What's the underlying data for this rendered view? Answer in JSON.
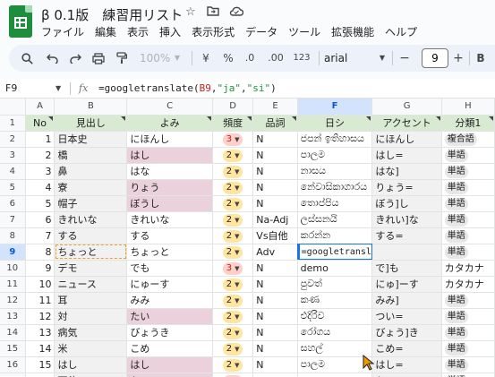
{
  "app": {
    "title": "β 0.1版　練習用リスト",
    "menu": [
      "ファイル",
      "編集",
      "表示",
      "挿入",
      "表示形式",
      "データ",
      "ツール",
      "拡張機能",
      "ヘルプ"
    ]
  },
  "toolbar": {
    "zoom": "100%",
    "currency": "¥",
    "percent": "%",
    "dec_decrease": ".0",
    "dec_increase": ".00",
    "number_format": "123",
    "font": "arial",
    "font_size": "9",
    "minus": "−",
    "plus": "+",
    "bold": "B"
  },
  "formula_bar": {
    "name_box": "F9",
    "fx": "fx",
    "formula_prefix": "=googletranslate(",
    "formula_ref": "B9",
    "formula_mid": ",",
    "formula_str1": "\"ja\"",
    "formula_comma": ",",
    "formula_str2": "\"si\"",
    "formula_suffix": ")"
  },
  "columns": [
    "A",
    "B",
    "C",
    "D",
    "E",
    "F",
    "G",
    "H"
  ],
  "header_row": {
    "row": "1",
    "cells": [
      "No",
      "見出し",
      "よみ",
      "頻度",
      "品詞",
      "日シ",
      "アクセント",
      "分類1"
    ]
  },
  "rows": [
    {
      "row": "2",
      "no": "1",
      "word": "日本史",
      "yomi": "にほんし",
      "freq": "3",
      "pos": "N",
      "si": "ජපන් ඉතිහාසය",
      "accent": "にほんし",
      "cat": "複合語"
    },
    {
      "row": "3",
      "no": "2",
      "word": "橋",
      "yomi": "はし",
      "freq": "2",
      "pos": "N",
      "si": "පාලම",
      "accent": "はし=",
      "cat": "単語"
    },
    {
      "row": "4",
      "no": "3",
      "word": "鼻",
      "yomi": "はな",
      "freq": "2",
      "pos": "N",
      "si": "නාසය",
      "accent": "はな]",
      "cat": "単語"
    },
    {
      "row": "5",
      "no": "4",
      "word": "寮",
      "yomi": "りょう",
      "freq": "2",
      "pos": "N",
      "si": "නේවාසිකාගාරය",
      "accent": "りょう=",
      "cat": "単語"
    },
    {
      "row": "6",
      "no": "5",
      "word": "帽子",
      "yomi": "ぼうし",
      "freq": "2",
      "pos": "N",
      "si": "තොප්පිය",
      "accent": "ぼう]し",
      "cat": "単語"
    },
    {
      "row": "7",
      "no": "6",
      "word": "きれいな",
      "yomi": "きれいな",
      "freq": "2",
      "pos": "Na-Adj",
      "si": "ලස්සනයි",
      "accent": "きれい]な",
      "cat": "単語"
    },
    {
      "row": "8",
      "no": "7",
      "word": "する",
      "yomi": "する",
      "freq": "2",
      "pos": "Vs自他",
      "si": "කරන්න",
      "accent": "する=",
      "cat": "単語"
    },
    {
      "row": "9",
      "no": "8",
      "word": "ちょっと",
      "yomi": "ちょっと",
      "freq": "2",
      "pos": "Adv",
      "si": "",
      "accent": "",
      "cat": "単語"
    },
    {
      "row": "10",
      "no": "9",
      "word": "デモ",
      "yomi": "でも",
      "freq": "3",
      "pos": "N",
      "si": "demo",
      "accent": "で]も",
      "cat": "カタカナ"
    },
    {
      "row": "11",
      "no": "10",
      "word": "ニュース",
      "yomi": "にゅーす",
      "freq": "2",
      "pos": "N",
      "si": "පුවත්",
      "accent": "にゅ]ーす",
      "cat": "カタカナ"
    },
    {
      "row": "12",
      "no": "11",
      "word": "耳",
      "yomi": "みみ",
      "freq": "2",
      "pos": "N",
      "si": "කණ",
      "accent": "みみ]",
      "cat": "単語"
    },
    {
      "row": "13",
      "no": "12",
      "word": "対",
      "yomi": "たい",
      "freq": "2",
      "pos": "N",
      "si": "එදිරිව",
      "accent": "つい=",
      "cat": "単語"
    },
    {
      "row": "14",
      "no": "13",
      "word": "病気",
      "yomi": "びょうき",
      "freq": "2",
      "pos": "N",
      "si": "රෝගය",
      "accent": "びょう]き",
      "cat": "単語"
    },
    {
      "row": "15",
      "no": "14",
      "word": "米",
      "yomi": "こめ",
      "freq": "2",
      "pos": "N",
      "si": "සහල්",
      "accent": "こめ=",
      "cat": "単語"
    },
    {
      "row": "16",
      "no": "15",
      "word": "はし",
      "yomi": "はし",
      "freq": "2",
      "pos": "N",
      "si": "පාලම",
      "accent": "はし=",
      "cat": "単語"
    },
    {
      "row": "17",
      "no": "16",
      "word": "下位",
      "yomi": "かい",
      "freq": "3",
      "pos": "N",
      "si": "පහළ",
      "accent": "か]い",
      "cat": "単語"
    }
  ],
  "edit_cell": {
    "badge": "?",
    "text_prefix": "=googletranslate(",
    "text_ref": "B9",
    "text_mid": ",",
    "text_str1": "\"ja\"",
    "text_comma": ",",
    "text_str2": "\"si\"",
    "text_suffix": ")"
  },
  "colors": {
    "header_green": "#d9ead3",
    "pink": "#ead1dc",
    "chip_yellow": "#ffe5a0",
    "chip_red": "#ffcfc9",
    "selection_blue": "#1a73e8"
  }
}
